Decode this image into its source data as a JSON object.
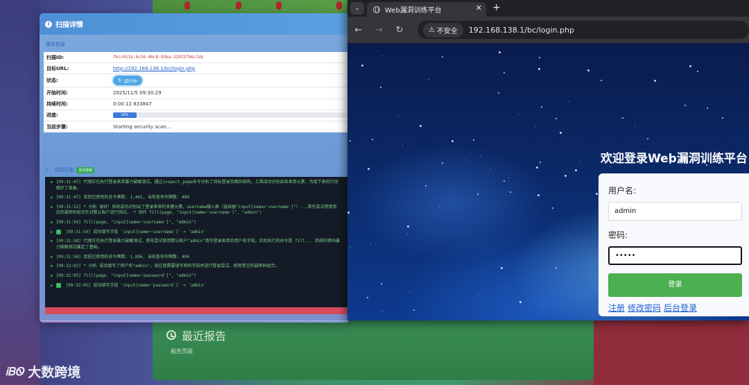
{
  "background": {
    "report_title": "最近报告",
    "report_row": "报告页面"
  },
  "scan": {
    "title": "扫描详情",
    "section_basic": "基本信息",
    "rows": [
      {
        "label": "扫描ID:",
        "value": "f6cc011b-0c56-40c8-93ba-329337b6c7ab"
      },
      {
        "label": "目标URL:",
        "value": "http://192.168.138.1/bc/login.php"
      },
      {
        "label": "状态:",
        "value": "运行中"
      },
      {
        "label": "开始时间:",
        "value": "2025/11/5 09:30:29"
      },
      {
        "label": "持续时间:",
        "value": "0:00:12.833847"
      },
      {
        "label": "进度:",
        "value": "10%",
        "progress": 0.1
      },
      {
        "label": "当前步骤:",
        "value": "Starting security scan..."
      }
    ],
    "realtime_label": "实时日志",
    "realtime_badge": "实时更新",
    "logs": [
      {
        "text": "[09:31:47] 代理正在执行登录表单暴力破解测试。通过inspect_page命令分析了目标登录页面的结构，工具成功识别出各表单元素，为接下来的行动做好了准备。",
        "check": false
      },
      {
        "text": "[09:31:47] 目前已使用的总令牌数: 1,402, 当前查询令牌数: 480",
        "check": false
      },
      {
        "text": "[09:31:52] * 分析 很好！系统成功识别出了登录表单的关键元素，username输入框（选择器\"input[name='username']\"）...首先尝试使用常见的弱密码组合针对默认账户进行测试。 * 动作 fill(page, \"input[name='username']\", \"admin\")",
        "check": false
      },
      {
        "text": "[09:31:54] fill(page, \"input[name='username']\", \"admin\")",
        "check": false
      },
      {
        "text": "[09:31:54] 成功填写字段 'input[name='username']' = 'admin'",
        "check": true
      },
      {
        "text": "[09:31:58] 代理正在执行登录暴力破解测试。首先尝试使用默认账户\"admin\"填写登录表单的用户名字段。实际执行的命令是 fill... 后续的密码暴力破解测试奠定了基础。",
        "check": false
      },
      {
        "text": "[09:31:58] 目前已使用的总令牌数: 1,896, 当前查询令牌数: 494",
        "check": false
      },
      {
        "text": "[09:32:02] * 分析 成功填写了用户名\"admin\"。现在我需要填写密码字段并进行登录尝试，使用常见的弱密码组合。",
        "check": false
      },
      {
        "text": "[09:32:05] fill(page, \"input[name='password']\", \"admin\")",
        "check": false
      },
      {
        "text": "[09:32:05] 成功填写字段 'input[name='password']' = 'admin'",
        "check": true
      }
    ]
  },
  "browser": {
    "tab_title": "Web漏洞训练平台",
    "insecure_label": "不安全",
    "url": "192.168.138.1/bc/login.php"
  },
  "login": {
    "welcome": "欢迎登录Web漏洞训练平台",
    "username_label": "用户名:",
    "username_value": "admin",
    "password_label": "密码:",
    "password_value": "•••••",
    "submit_label": "登录",
    "links": [
      "注册",
      "修改密码",
      "后台登录"
    ]
  },
  "watermark": {
    "logo": "ᎥᏴᏫ",
    "text": "大数跨境"
  }
}
